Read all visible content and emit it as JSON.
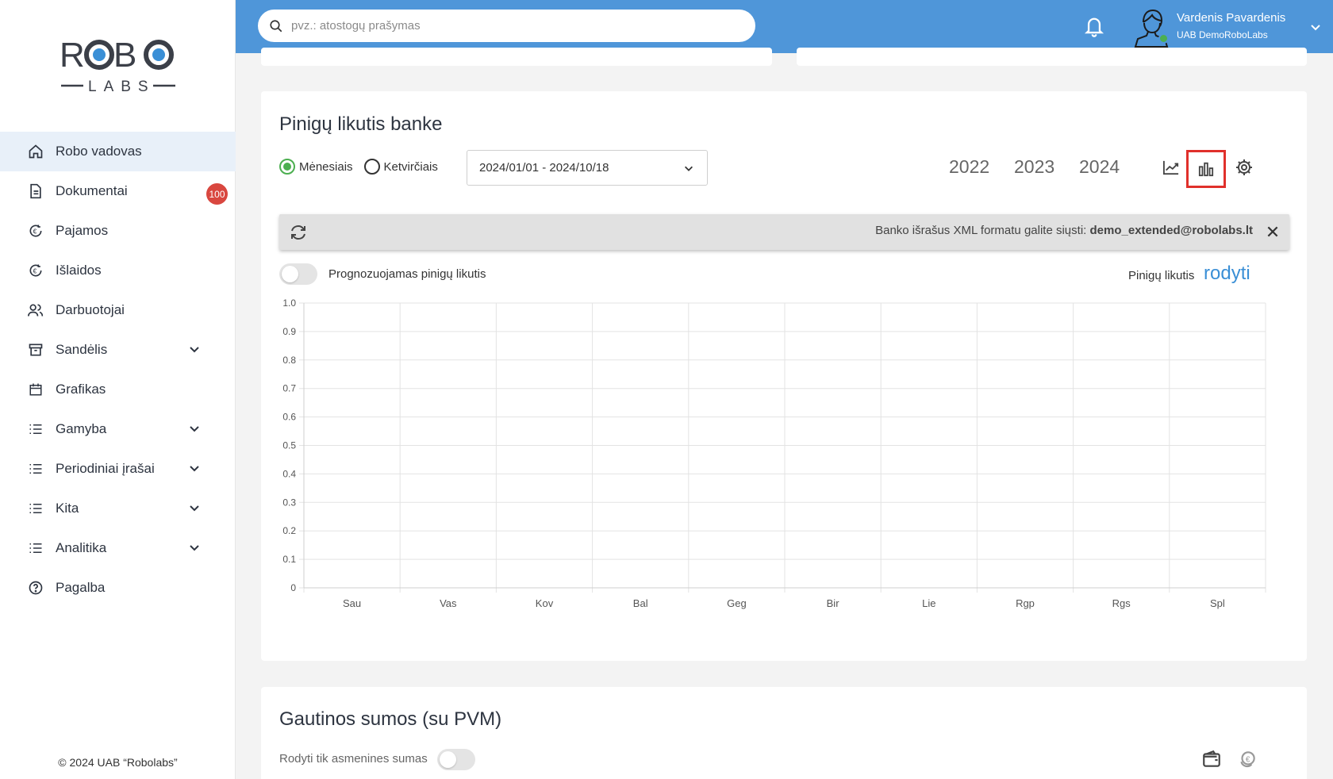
{
  "sidebar": {
    "logo_top": "ROBO",
    "logo_bottom": "LABS",
    "items": [
      {
        "label": "Robo vadovas",
        "icon": "home-icon",
        "active": true
      },
      {
        "label": "Dokumentai",
        "icon": "document-icon",
        "badge": "100"
      },
      {
        "label": "Pajamos",
        "icon": "income-icon"
      },
      {
        "label": "Išlaidos",
        "icon": "expense-icon"
      },
      {
        "label": "Darbuotojai",
        "icon": "users-icon"
      },
      {
        "label": "Sandėlis",
        "icon": "archive-icon",
        "expandable": true
      },
      {
        "label": "Grafikas",
        "icon": "calendar-icon"
      },
      {
        "label": "Gamyba",
        "icon": "list-icon",
        "expandable": true
      },
      {
        "label": "Periodiniai įrašai",
        "icon": "list-icon",
        "expandable": true
      },
      {
        "label": "Kita",
        "icon": "list-icon",
        "expandable": true
      },
      {
        "label": "Analitika",
        "icon": "list-icon",
        "expandable": true
      },
      {
        "label": "Pagalba",
        "icon": "help-icon"
      }
    ],
    "footer": "© 2024 UAB “Robolabs”"
  },
  "topbar": {
    "search_placeholder": "pvz.: atostogų prašymas",
    "user_name": "Vardenis Pavardenis",
    "company": "UAB DemoRoboLabs"
  },
  "bank_card": {
    "title": "Pinigų likutis banke",
    "radio_monthly": "Mėnesiais",
    "radio_quarterly": "Ketvirčiais",
    "date_range": "2024/01/01 - 2024/10/18",
    "years": [
      "2022",
      "2023",
      "2024"
    ],
    "info_text": "Banko išrašus XML formatu galite siųsti:",
    "info_email": "demo_extended@robolabs.lt",
    "forecast_toggle_label": "Prognozuojamas pinigų likutis",
    "balance_label": "Pinigų likutis",
    "balance_link": "rodyti"
  },
  "chart_data": {
    "type": "bar",
    "categories": [
      "Sau",
      "Vas",
      "Kov",
      "Bal",
      "Geg",
      "Bir",
      "Lie",
      "Rgp",
      "Rgs",
      "Spl"
    ],
    "values": [],
    "yticks": [
      "0",
      "0.1",
      "0.2",
      "0.3",
      "0.4",
      "0.5",
      "0.6",
      "0.7",
      "0.8",
      "0.9",
      "1.0"
    ],
    "ylim": [
      0,
      1
    ],
    "grid": true,
    "title": "",
    "xlabel": "",
    "ylabel": ""
  },
  "received_card": {
    "title": "Gautinos sumos (su PVM)",
    "toggle_label": "Rodyti tik asmenines sumas"
  },
  "colors": {
    "topbar": "#4f96d9",
    "active_nav": "#e8f0f9",
    "badge": "#d9473f",
    "highlight": "#e0302b",
    "link": "#3a8fd6",
    "radio_on": "#4caf50"
  }
}
